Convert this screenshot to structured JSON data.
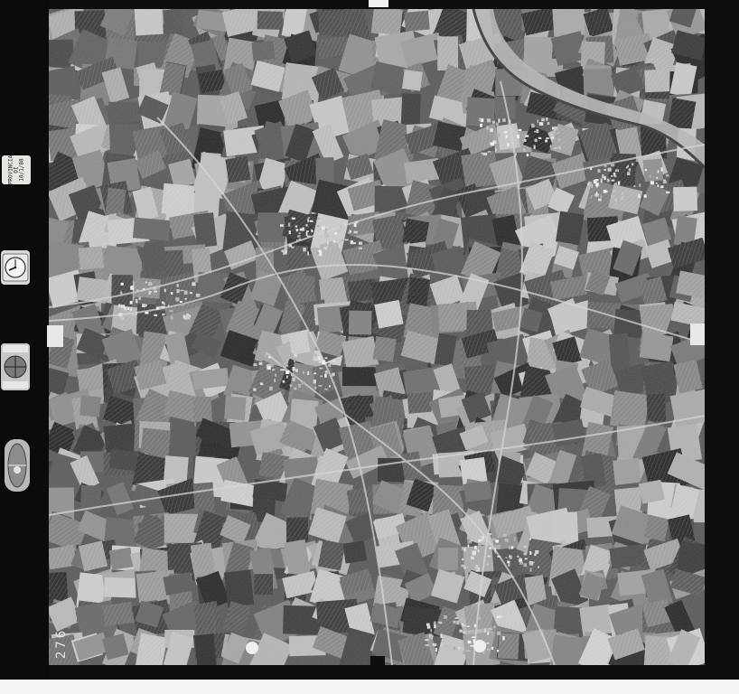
{
  "image": {
    "kind": "aerial photograph",
    "content": "black-and-white aerial view of agricultural fields with a river, roads and small villages"
  },
  "film_annotations": {
    "frame_number": "276",
    "note_card": "PROVINCIA\nDI\n10/1/88"
  },
  "instruments": {
    "clock_icon": "clock-icon",
    "altimeter_icon": "altimeter-icon",
    "level_icon": "level-bubble-icon"
  },
  "colors": {
    "film_border": "#0e0e0e",
    "river": "#b7b7b7",
    "fields_dark": "#2e2e2e",
    "fields_light": "#cfcfcf"
  }
}
